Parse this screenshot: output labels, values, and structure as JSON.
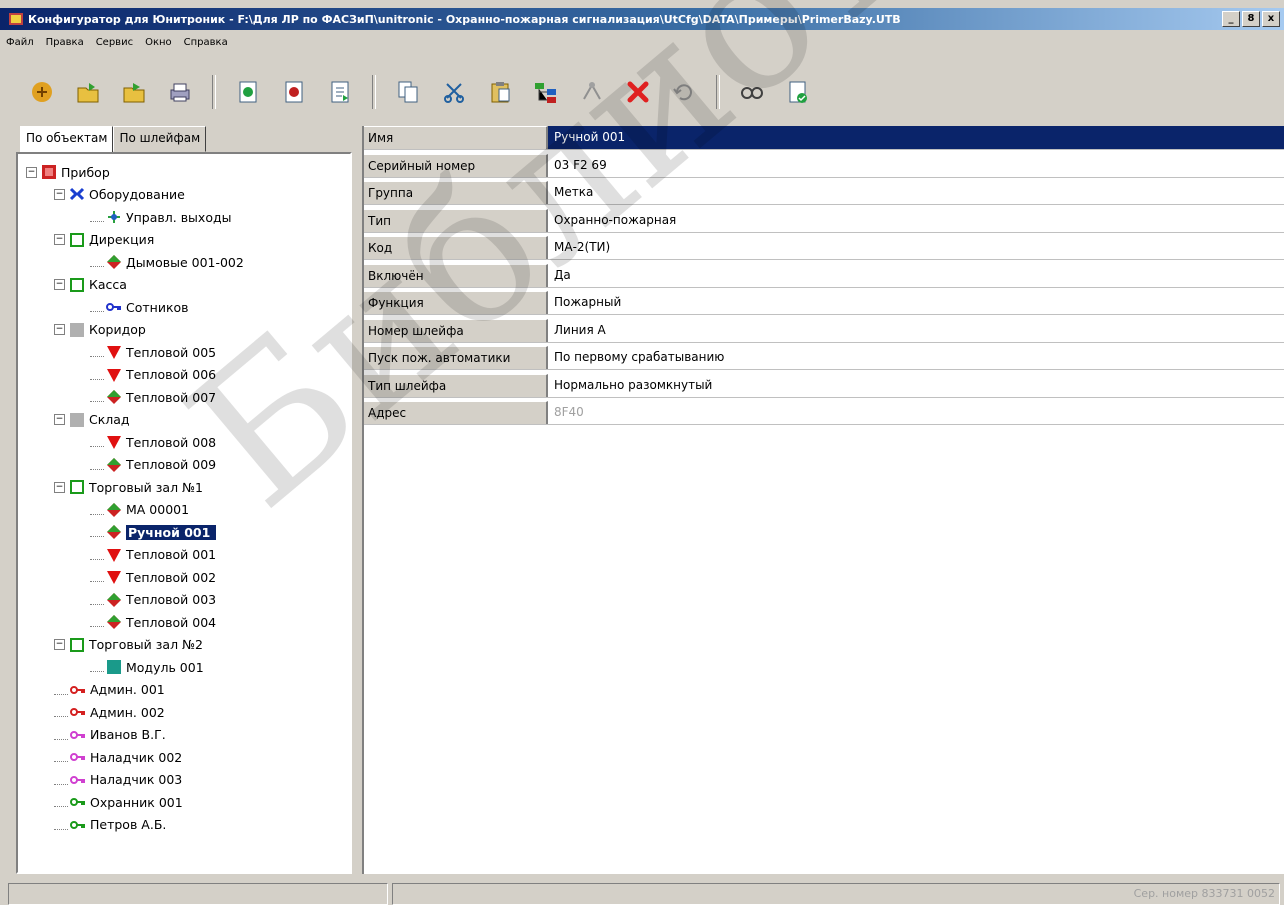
{
  "window": {
    "title": "Конфигуратор для Юнитроник - F:\\Для ЛР по ФАСЗиП\\unitronic - Охранно-пожарная сигнализация\\UtCfg\\DATA\\Примеры\\PrimerBazy.UTB",
    "controls": [
      "_",
      "8",
      "x"
    ]
  },
  "menu": [
    "Файл",
    "Правка",
    "Сервис",
    "Окно",
    "Справка"
  ],
  "toolbar": {
    "icons": [
      "open-folder-icon",
      "open-icon",
      "open-alt-icon",
      "print-icon",
      "import-icon",
      "export-icon",
      "document-icon",
      "copy-icon",
      "cut-icon",
      "paste-icon",
      "tree-icon",
      "link-icon",
      "delete-icon",
      "undo-icon",
      "find-icon",
      "check-document-icon"
    ]
  },
  "tabs": [
    "По объектам",
    "По шлейфам"
  ],
  "tree": [
    {
      "label": "Прибор",
      "icon": "device-icon",
      "color": "#cc2222",
      "level": 0,
      "exp": "−"
    },
    {
      "label": "Оборудование",
      "icon": "equipment-icon",
      "color": "#1a3fd0",
      "level": 1,
      "exp": "−"
    },
    {
      "label": "Управл. выходы",
      "icon": "outputs-icon",
      "color": "#2aa040",
      "level": 2
    },
    {
      "label": "Дирекция",
      "icon": "zone-icon",
      "color": "#1a9a1a",
      "level": 1,
      "exp": "−"
    },
    {
      "label": "Дымовые 001-002",
      "icon": "sensor-diamond-icon",
      "color": "#cc2222",
      "level": 2
    },
    {
      "label": "Касса",
      "icon": "zone-icon",
      "color": "#1a9a1a",
      "level": 1,
      "exp": "−"
    },
    {
      "label": "Сотников",
      "icon": "key-icon",
      "color": "#2233cc",
      "level": 2
    },
    {
      "label": "Коридор",
      "icon": "zone-grey-icon",
      "color": "#b0b0b0",
      "level": 1,
      "exp": "−"
    },
    {
      "label": "Тепловой  005",
      "icon": "sensor-triangle-icon",
      "color": "#e01010",
      "level": 2
    },
    {
      "label": "Тепловой  006",
      "icon": "sensor-triangle-icon",
      "color": "#e01010",
      "level": 2
    },
    {
      "label": "Тепловой  007",
      "icon": "sensor-diamond-icon",
      "color": "#cc2222",
      "level": 2
    },
    {
      "label": "Склад",
      "icon": "zone-grey-icon",
      "color": "#b0b0b0",
      "level": 1,
      "exp": "−"
    },
    {
      "label": "Тепловой  008",
      "icon": "sensor-triangle-icon",
      "color": "#e01010",
      "level": 2
    },
    {
      "label": "Тепловой  009",
      "icon": "sensor-diamond-icon",
      "color": "#cc2222",
      "level": 2
    },
    {
      "label": "Торговый зал №1",
      "icon": "zone-icon",
      "color": "#1a9a1a",
      "level": 1,
      "exp": "−"
    },
    {
      "label": "МА     00001",
      "icon": "sensor-diamond-icon",
      "color": "#cc2222",
      "level": 2
    },
    {
      "label": "Ручной   001",
      "icon": "sensor-diamond-icon",
      "color": "#cc2222",
      "level": 2,
      "selected": true
    },
    {
      "label": "Тепловой  001",
      "icon": "sensor-triangle-icon",
      "color": "#e01010",
      "level": 2
    },
    {
      "label": "Тепловой  002",
      "icon": "sensor-triangle-icon",
      "color": "#e01010",
      "level": 2
    },
    {
      "label": "Тепловой  003",
      "icon": "sensor-diamond-icon",
      "color": "#cc2222",
      "level": 2
    },
    {
      "label": "Тепловой  004",
      "icon": "sensor-diamond-icon",
      "color": "#cc2222",
      "level": 2
    },
    {
      "label": "Торговый зал №2",
      "icon": "zone-icon",
      "color": "#1a9a1a",
      "level": 1,
      "exp": "−"
    },
    {
      "label": "Модуль   001",
      "icon": "module-icon",
      "color": "#1a9a8a",
      "level": 2
    },
    {
      "label": "Админ.   001",
      "icon": "key-icon",
      "color": "#d42020",
      "level": 1
    },
    {
      "label": "Админ.   002",
      "icon": "key-icon",
      "color": "#d42020",
      "level": 1
    },
    {
      "label": "Иванов В.Г.",
      "icon": "key-icon",
      "color": "#d040d0",
      "level": 1
    },
    {
      "label": "Наладчик  002",
      "icon": "key-icon",
      "color": "#d040d0",
      "level": 1
    },
    {
      "label": "Наладчик  003",
      "icon": "key-icon",
      "color": "#d040d0",
      "level": 1
    },
    {
      "label": "Охранник  001",
      "icon": "key-icon",
      "color": "#1a9a1a",
      "level": 1
    },
    {
      "label": "Петров А.Б.",
      "icon": "key-icon",
      "color": "#1a9a1a",
      "level": 1
    }
  ],
  "properties": [
    {
      "key": "Имя",
      "value": "Ручной   001",
      "highlight": true
    },
    {
      "key": "Серийный номер",
      "value": "03 F2 69"
    },
    {
      "key": "Группа",
      "value": "Метка"
    },
    {
      "key": "Тип",
      "value": "Охранно-пожарная"
    },
    {
      "key": "Код",
      "value": "МА-2(ТИ)"
    },
    {
      "key": "Включён",
      "value": "Да"
    },
    {
      "key": "Функция",
      "value": "Пожарный"
    },
    {
      "key": "Номер шлейфа",
      "value": "Линия А"
    },
    {
      "key": "Пуск пож. автоматики",
      "value": "По первому срабатыванию"
    },
    {
      "key": "Тип шлейфа",
      "value": "Нормально разомкнутый"
    },
    {
      "key": "Адрес",
      "value": "8F40",
      "muted": true
    }
  ],
  "status": {
    "serial": "Сер. номер 833731 0052"
  },
  "watermark": "Библиотека БГУИР",
  "colors": {
    "selection": "#0a246a",
    "face": "#d4d0c8"
  }
}
